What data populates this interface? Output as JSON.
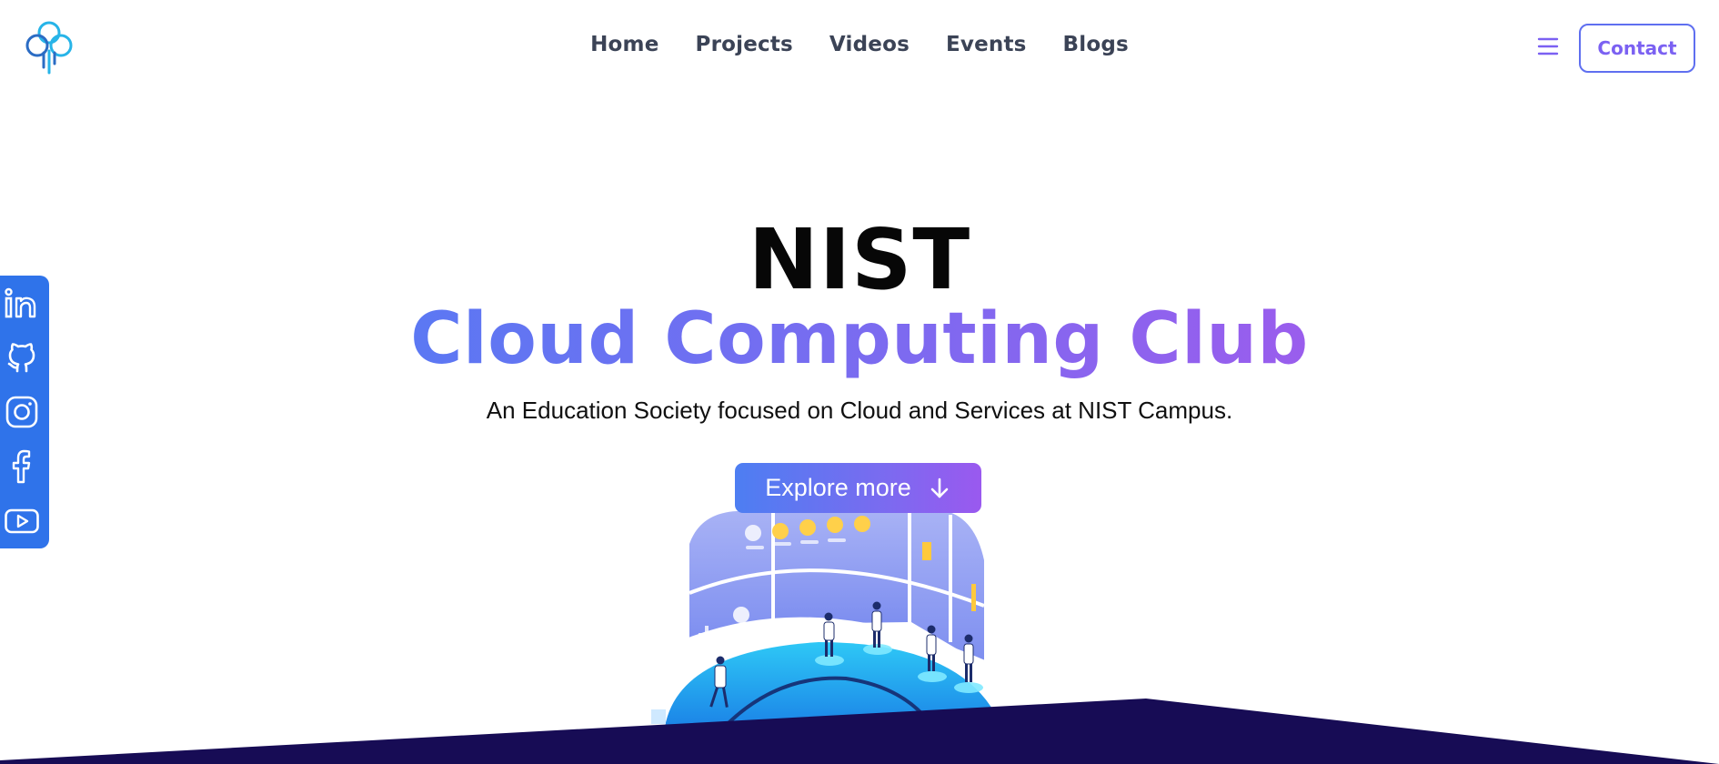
{
  "header": {
    "logo_icon": "cloud-logo-icon",
    "nav": [
      {
        "label": "Home"
      },
      {
        "label": "Projects"
      },
      {
        "label": "Videos"
      },
      {
        "label": "Events"
      },
      {
        "label": "Blogs"
      }
    ],
    "menu_icon": "hamburger-menu-icon",
    "contact_label": "Contact"
  },
  "hero": {
    "title": "NIST",
    "subtitle": "Cloud Computing Club",
    "description": "An Education Society focused on Cloud and Services at NIST Campus.",
    "explore_label": "Explore more",
    "explore_icon": "arrow-down-icon"
  },
  "social": [
    {
      "icon": "linkedin-icon"
    },
    {
      "icon": "github-icon"
    },
    {
      "icon": "instagram-icon"
    },
    {
      "icon": "facebook-icon"
    },
    {
      "icon": "youtube-icon"
    }
  ],
  "colors": {
    "accent_blue": "#2f73ea",
    "gradient_start": "#5b78f3",
    "gradient_end": "#9a5ded",
    "nav_text": "#3b4356",
    "footer_dark": "#170c55"
  }
}
